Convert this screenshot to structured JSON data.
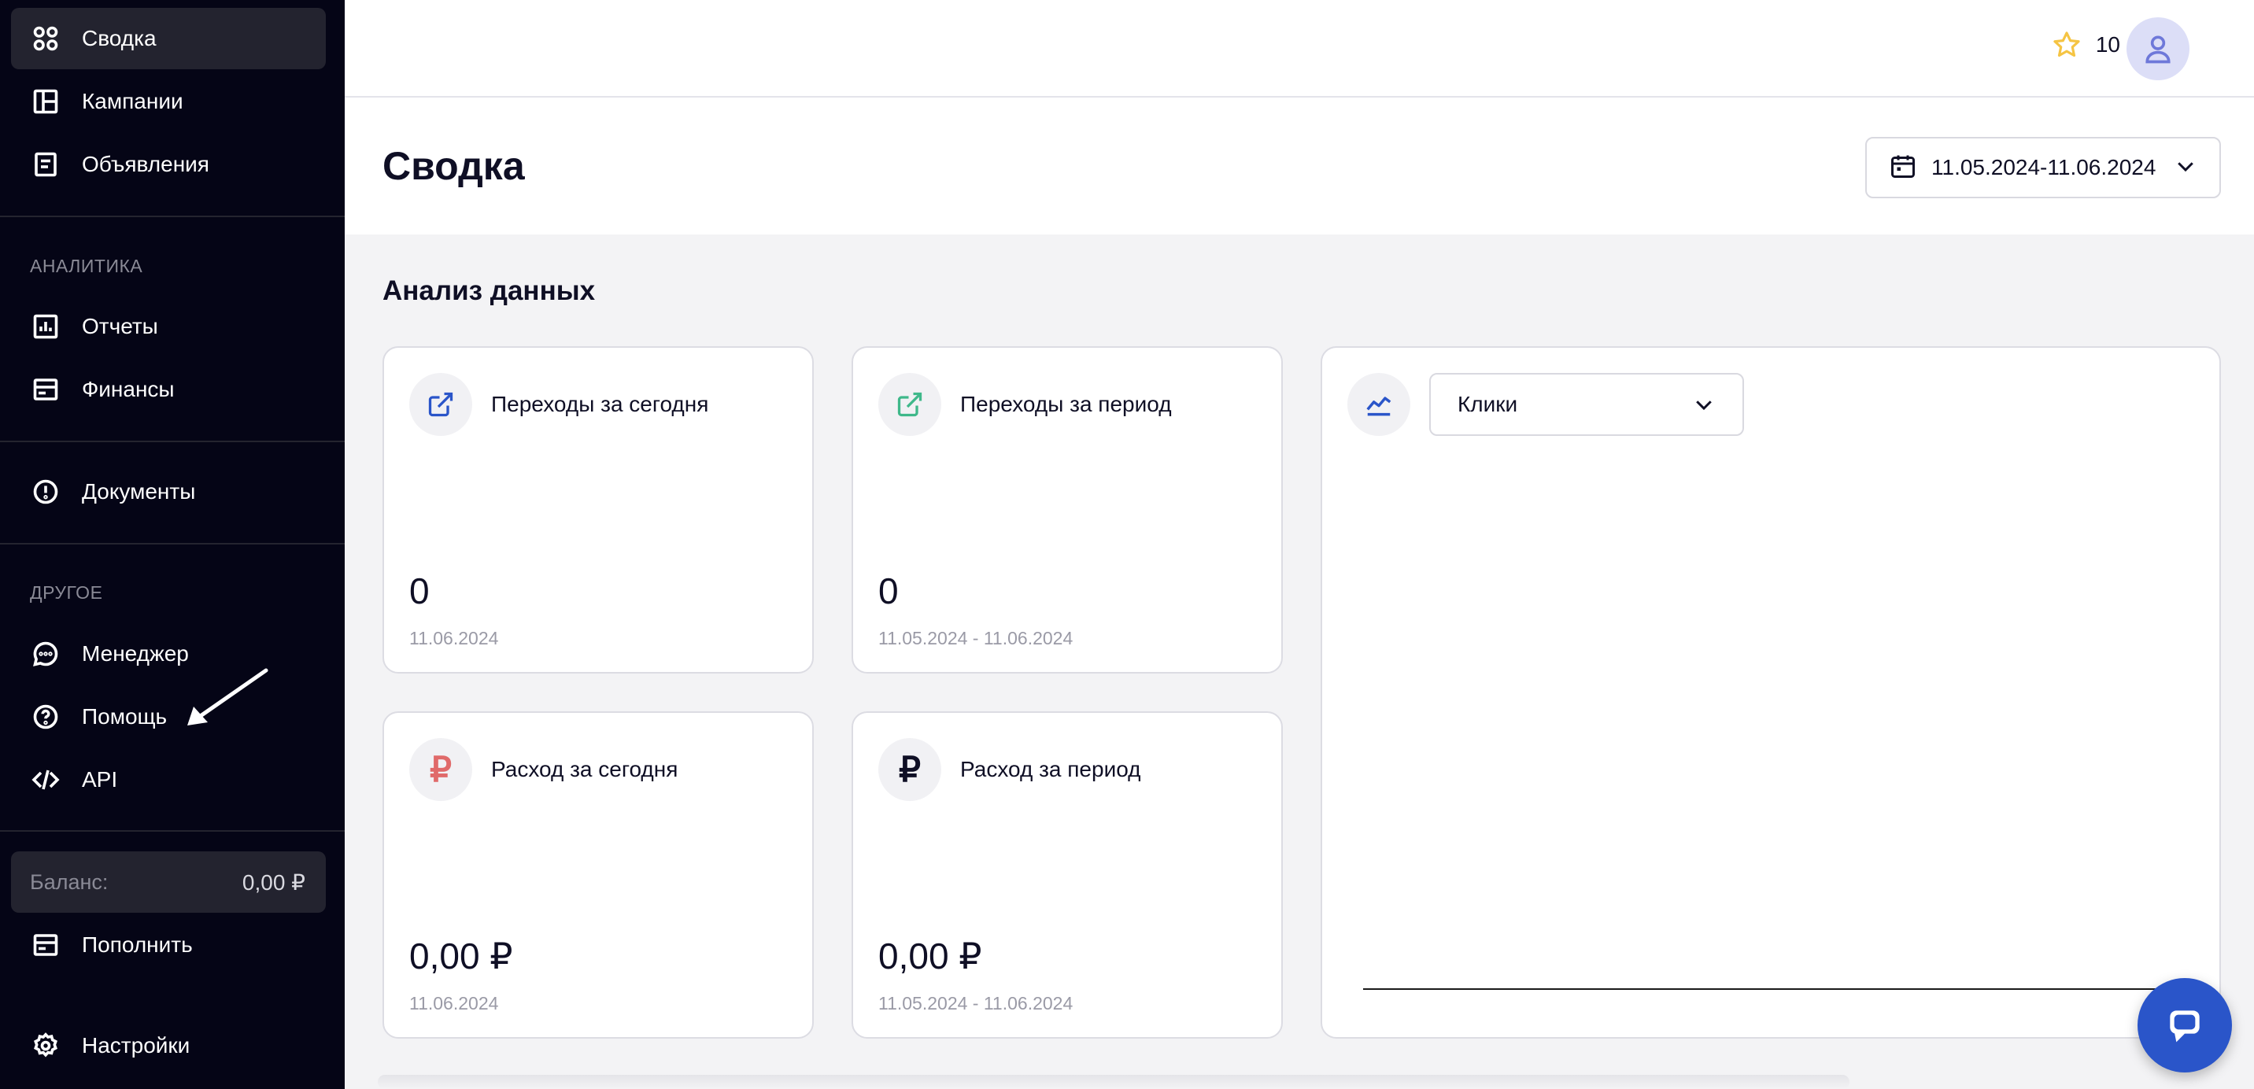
{
  "sidebar": {
    "items": [
      {
        "label": "Сводка"
      },
      {
        "label": "Кампании"
      },
      {
        "label": "Объявления"
      },
      {
        "label": "Отчеты"
      },
      {
        "label": "Финансы"
      },
      {
        "label": "Документы"
      },
      {
        "label": "Менеджер"
      },
      {
        "label": "Помощь"
      },
      {
        "label": "API"
      },
      {
        "label": "Пополнить"
      },
      {
        "label": "Настройки"
      }
    ],
    "sections": {
      "analytics": "АНАЛИТИКА",
      "other": "ДРУГОЕ"
    },
    "balance": {
      "label": "Баланс:",
      "value": "0,00 ₽"
    }
  },
  "header": {
    "score": "10"
  },
  "page": {
    "title": "Сводка",
    "date_range": "11.05.2024-11.06.2024",
    "section_heading": "Анализ данных"
  },
  "cards": [
    {
      "title": "Переходы за сегодня",
      "value": "0",
      "date": "11.06.2024"
    },
    {
      "title": "Переходы за период",
      "value": "0",
      "date": "11.05.2024 - 11.06.2024"
    },
    {
      "title": "Расход за сегодня",
      "value": "0,00 ₽",
      "date": "11.06.2024"
    },
    {
      "title": "Расход за период",
      "value": "0,00 ₽",
      "date": "11.05.2024 - 11.06.2024"
    }
  ],
  "chart": {
    "metric": "Клики"
  },
  "icons": {
    "rub_symbol": "₽"
  },
  "colors": {
    "sidebar_bg": "#050516",
    "accent_blue": "#2a55c9",
    "star": "#f5c443",
    "rub_red": "#e06a6a",
    "link_green": "#3fb88a"
  }
}
